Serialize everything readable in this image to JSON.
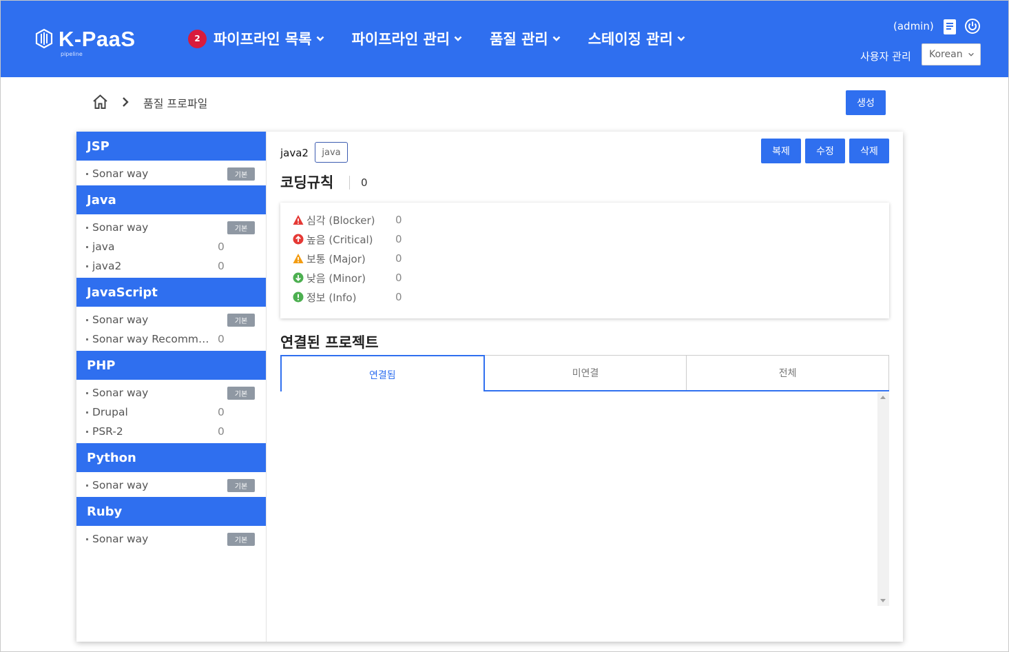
{
  "header": {
    "logo_text": "K-PaaS",
    "logo_sub": "pipeline",
    "nav": [
      {
        "label": "파이프라인 목록",
        "badge": "2"
      },
      {
        "label": "파이프라인 관리"
      },
      {
        "label": "품질 관리"
      },
      {
        "label": "스테이징 관리"
      }
    ],
    "user": "(admin)",
    "user_mgmt": "사용자 관리",
    "language": "Korean"
  },
  "breadcrumb": {
    "current": "품질 프로파일"
  },
  "actions": {
    "create": "생성"
  },
  "sidebar": {
    "badge_default": "기본",
    "groups": [
      {
        "name": "JSP",
        "profiles": [
          {
            "name": "Sonar way",
            "default": true
          }
        ]
      },
      {
        "name": "Java",
        "profiles": [
          {
            "name": "Sonar way",
            "default": true
          },
          {
            "name": "java",
            "count": "0"
          },
          {
            "name": "java2",
            "count": "0"
          }
        ]
      },
      {
        "name": "JavaScript",
        "profiles": [
          {
            "name": "Sonar way",
            "default": true
          },
          {
            "name": "Sonar way Recommended",
            "count": "0"
          }
        ]
      },
      {
        "name": "PHP",
        "profiles": [
          {
            "name": "Sonar way",
            "default": true
          },
          {
            "name": "Drupal",
            "count": "0"
          },
          {
            "name": "PSR-2",
            "count": "0"
          }
        ]
      },
      {
        "name": "Python",
        "profiles": [
          {
            "name": "Sonar way",
            "default": true
          }
        ]
      },
      {
        "name": "Ruby",
        "profiles": [
          {
            "name": "Sonar way",
            "default": true
          }
        ]
      }
    ]
  },
  "detail": {
    "profile_name": "java2",
    "language_tag": "java",
    "copy": "복제",
    "edit": "수정",
    "delete": "삭제",
    "rules_title": "코딩규칙",
    "rules_count": "0",
    "severities": [
      {
        "label": "심각 (Blocker)",
        "count": "0",
        "icon": "blocker-icon",
        "color": "#e53935"
      },
      {
        "label": "높음 (Critical)",
        "count": "0",
        "icon": "critical-icon",
        "color": "#e53935"
      },
      {
        "label": "보통 (Major)",
        "count": "0",
        "icon": "major-icon",
        "color": "#f39c12"
      },
      {
        "label": "낮음 (Minor)",
        "count": "0",
        "icon": "minor-icon",
        "color": "#4caf50"
      },
      {
        "label": "정보 (Info)",
        "count": "0",
        "icon": "info-icon",
        "color": "#4caf50"
      }
    ],
    "projects_title": "연결된 프로젝트",
    "tabs": [
      "연결됨",
      "미연결",
      "전체"
    ]
  }
}
